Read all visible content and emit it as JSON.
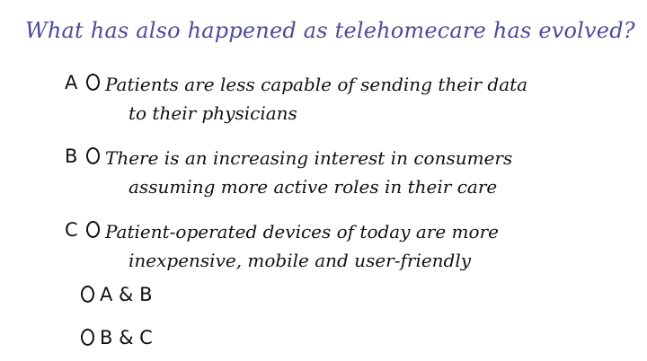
{
  "question": "What has also happened as telehomecare has evolved?",
  "options": [
    {
      "letter": "A",
      "line1": "Patients are less capable of sending their data",
      "line2": "to their physicians"
    },
    {
      "letter": "B",
      "line1": "There is an increasing interest in consumers",
      "line2": "assuming more active roles in their care"
    },
    {
      "letter": "C",
      "line1": "Patient-operated devices of today are more",
      "line2": "inexpensive, mobile and user-friendly"
    }
  ],
  "combos": [
    {
      "label": "A & B"
    },
    {
      "label": "B & C"
    }
  ]
}
